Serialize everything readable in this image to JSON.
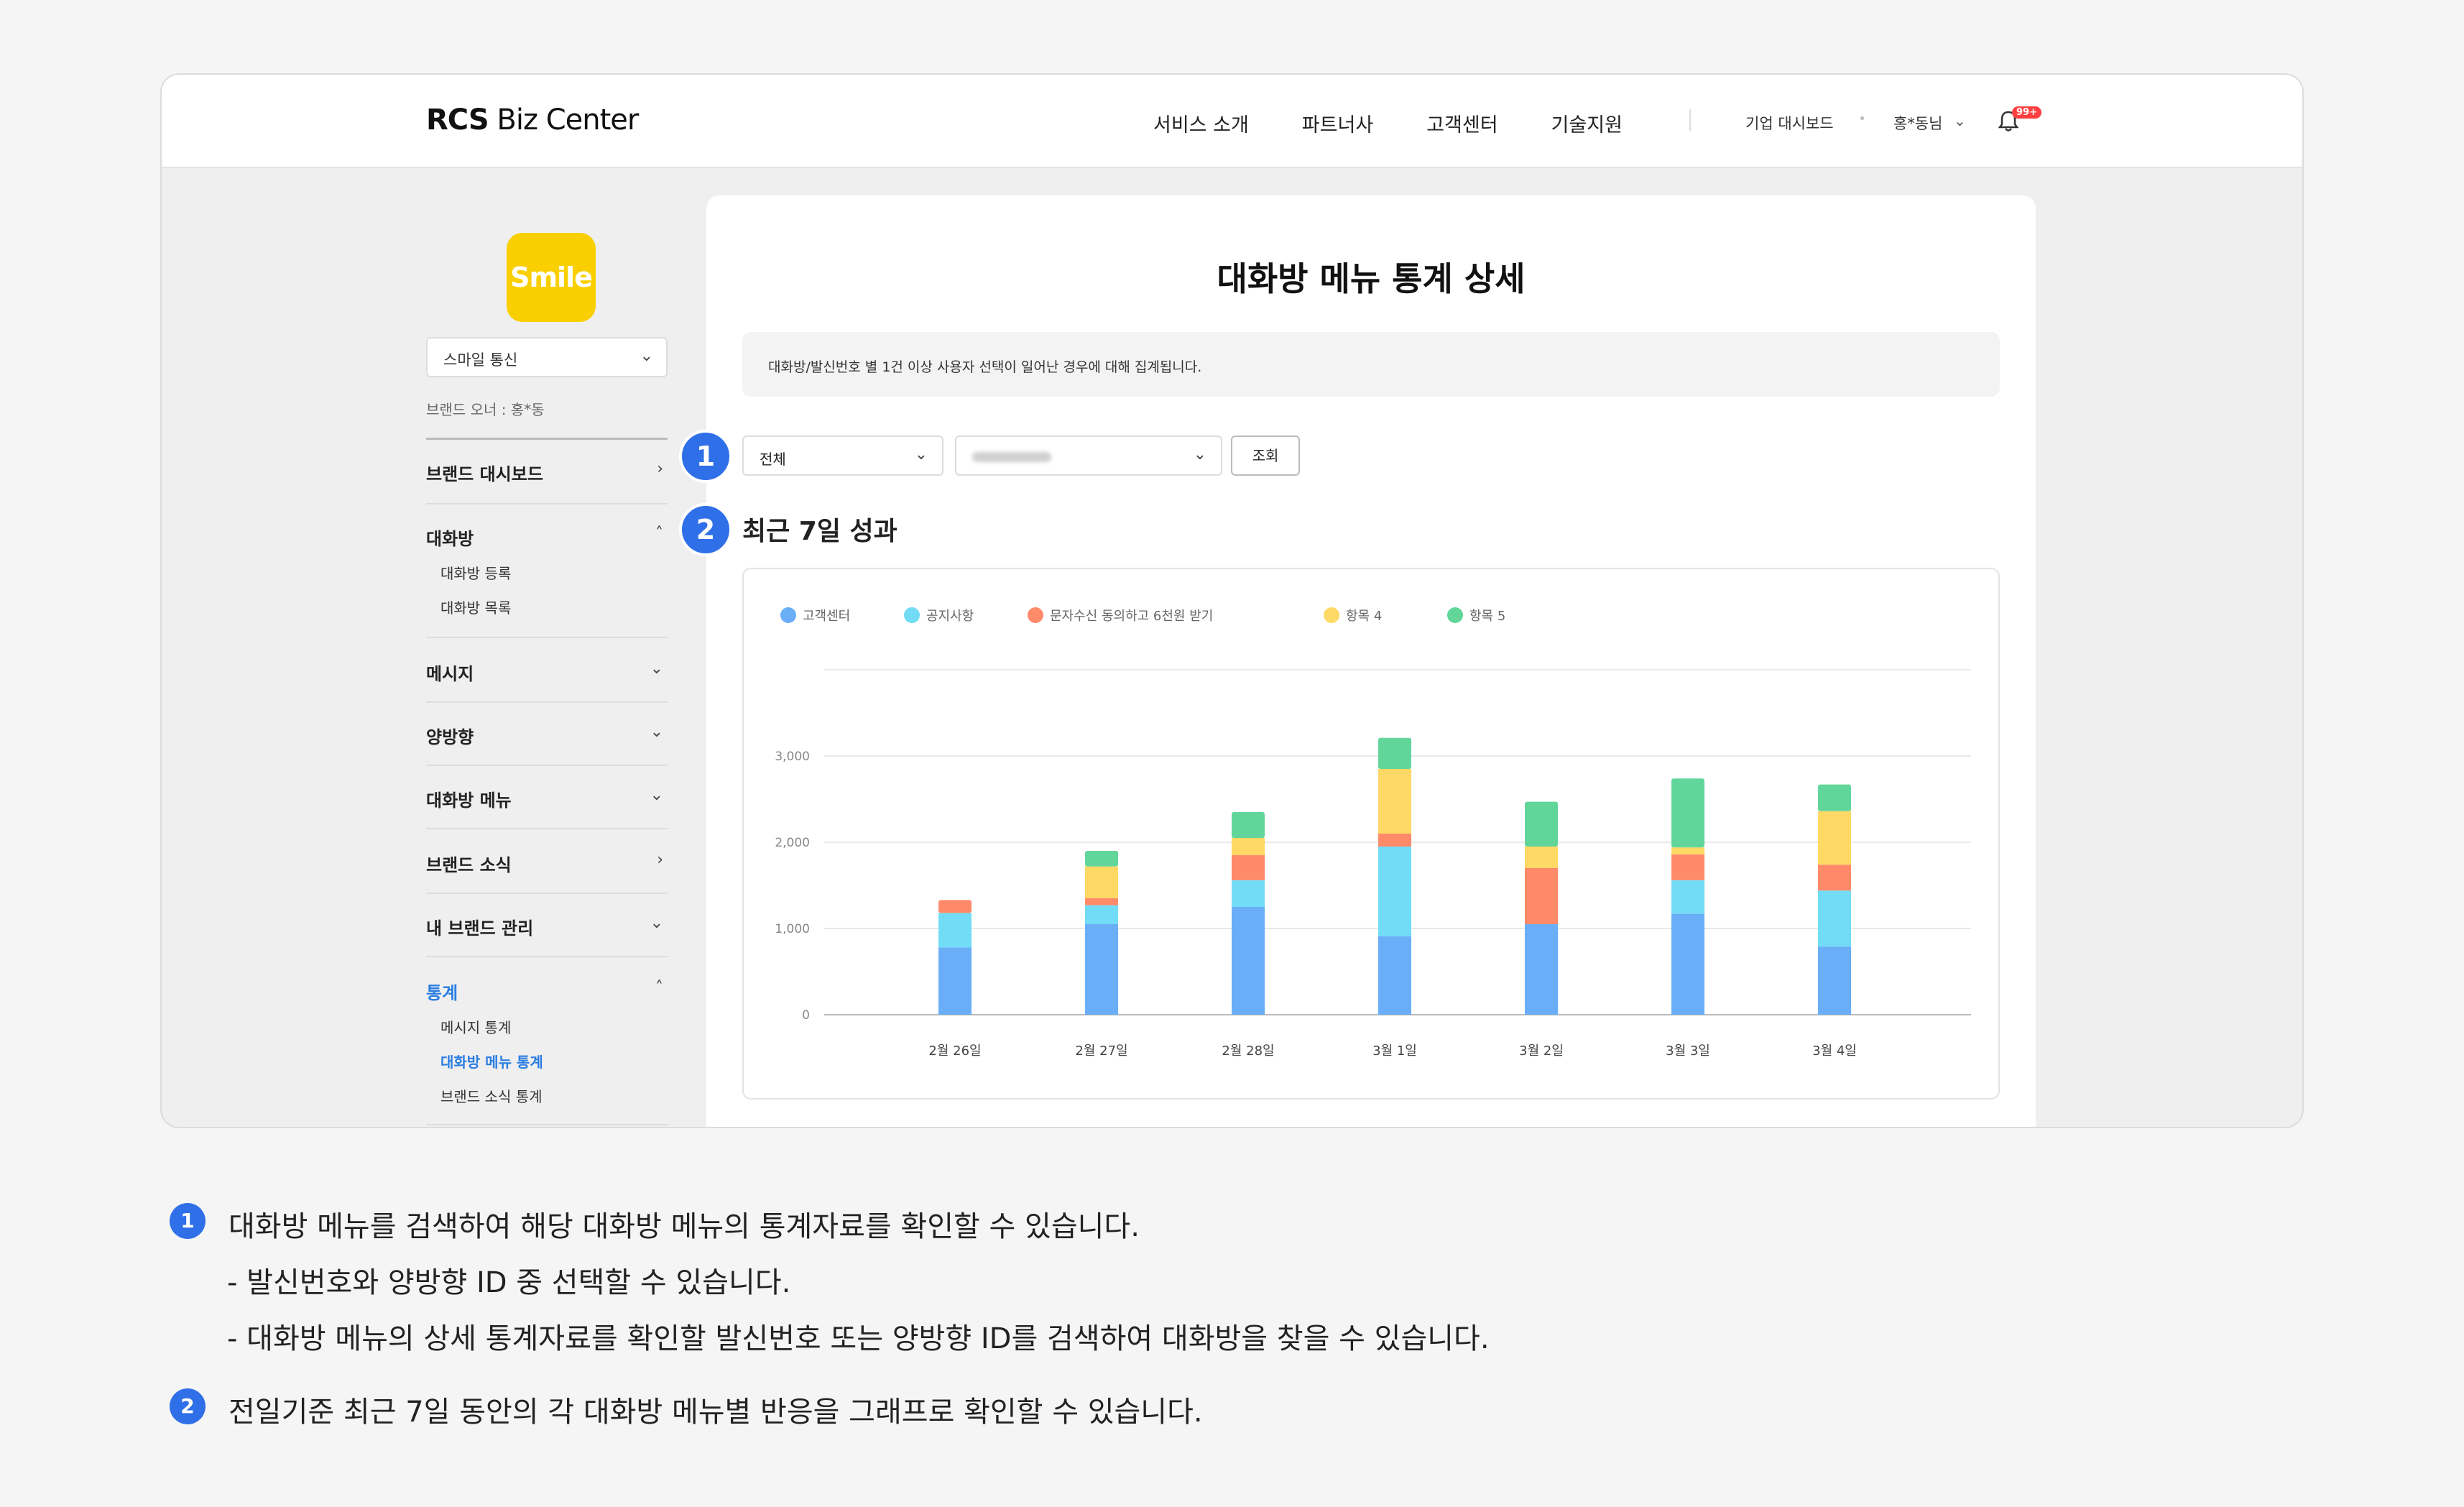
{
  "header": {
    "logo_bold": "RCS",
    "logo_rest": " Biz Center",
    "nav": [
      "서비스 소개",
      "파트너사",
      "고객센터",
      "기술지원"
    ],
    "corp_dashboard": "기업 대시보드",
    "user": "홍*동님",
    "badge": "99+"
  },
  "sidebar": {
    "logo_text": "Smile",
    "brand_select": "스마일 통신",
    "brand_owner": "브랜드 오너 : 홍*동",
    "menu": {
      "brand_dashboard": "브랜드 대시보드",
      "chatroom": "대화방",
      "chatroom_register": "대화방 등록",
      "chatroom_list": "대화방 목록",
      "message": "메시지",
      "two_way": "양방향",
      "chatroom_menu": "대화방 메뉴",
      "brand_news": "브랜드 소식",
      "my_brand": "내 브랜드 관리",
      "stats": "통계",
      "stats_message": "메시지 통계",
      "stats_chatroom_menu": "대화방 메뉴 통계",
      "stats_brand_news": "브랜드 소식 통계"
    }
  },
  "main": {
    "title": "대화방 메뉴 통계 상세",
    "notice": "대화방/발신번호 별 1건 이상 사용자 선택이 일어난 경우에 대해 집계됩니다.",
    "filter_all": "전체",
    "search_button": "조회",
    "section_title": "최근 7일 성과"
  },
  "callouts": [
    "1",
    "2"
  ],
  "chart_data": {
    "type": "bar",
    "stacked": true,
    "categories": [
      "2월 26일",
      "2월 27일",
      "2월 28일",
      "3월 1일",
      "3월 2일",
      "3월 3일",
      "3월 4일"
    ],
    "series": [
      {
        "name": "고객센터",
        "color": "#6aaef7",
        "values": [
          780,
          1050,
          1250,
          910,
          1050,
          1170,
          790
        ]
      },
      {
        "name": "공지사항",
        "color": "#72dcf7",
        "values": [
          400,
          220,
          310,
          1040,
          0,
          390,
          650
        ]
      },
      {
        "name": "문자수신 동의하고 6천원 받기",
        "color": "#ff8a6a",
        "values": [
          150,
          80,
          290,
          150,
          650,
          300,
          300
        ]
      },
      {
        "name": "항목 4",
        "color": "#ffd966",
        "values": [
          0,
          370,
          200,
          750,
          250,
          80,
          620
        ]
      },
      {
        "name": "항목 5",
        "color": "#62d69a",
        "values": [
          0,
          180,
          300,
          360,
          520,
          800,
          310
        ]
      }
    ],
    "yticks": [
      "0",
      "1,000",
      "2,000",
      "3,000"
    ],
    "ylim": [
      0,
      4000
    ],
    "grid": true,
    "legend_position": "top-left"
  },
  "descriptions": {
    "d1": "대화방 메뉴를 검색하여 해당 대화방 메뉴의 통계자료를 확인할 수 있습니다.",
    "d1a": "- 발신번호와 양방향 ID 중 선택할 수 있습니다.",
    "d1b": "- 대화방 메뉴의 상세 통계자료를 확인할 발신번호 또는 양방향 ID를 검색하여 대화방을 찾을 수 있습니다.",
    "d2": "전일기준 최근 7일 동안의 각 대화방 메뉴별 반응을 그래프로 확인할 수 있습니다."
  }
}
